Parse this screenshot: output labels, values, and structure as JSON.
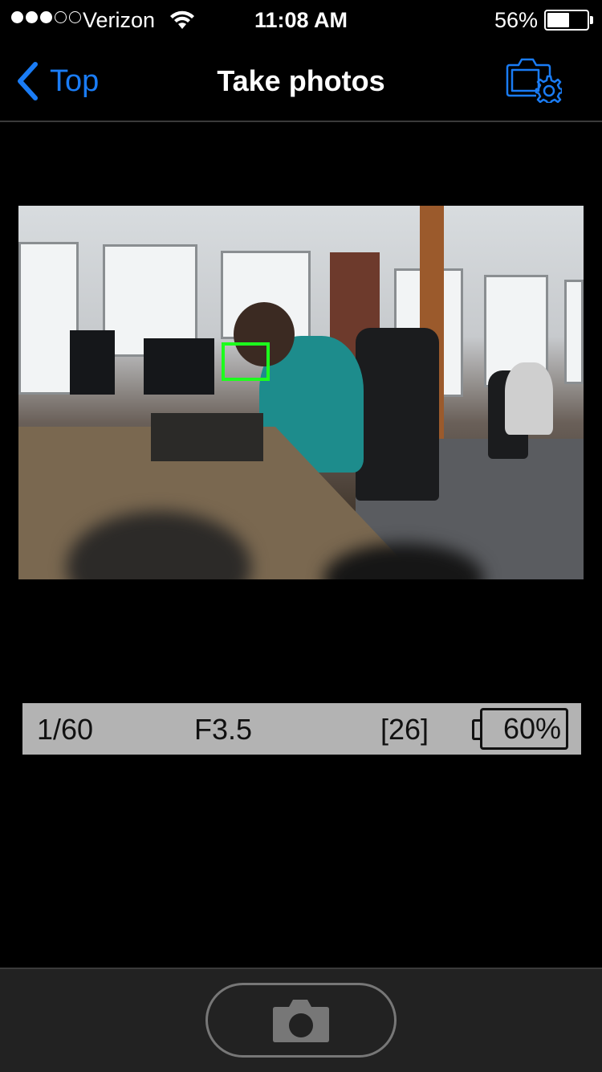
{
  "status_bar": {
    "signal_bars_filled": 3,
    "signal_bars_total": 5,
    "carrier": "Verizon",
    "wifi_icon": "wifi-icon",
    "time": "11:08 AM",
    "battery_percent_label": "56%",
    "battery_level": 0.56
  },
  "nav": {
    "back_label": "Top",
    "title": "Take photos",
    "settings_icon": "camera-settings-icon"
  },
  "live_view": {
    "description": "Live camera view of an office with a person at a desk",
    "focus_box_color": "#1dff1d"
  },
  "camera_info": {
    "shutter_speed": "1/60",
    "aperture": "F3.5",
    "remaining_shots": "[26]",
    "battery_label": "60%",
    "battery_level": 0.6
  },
  "toolbar": {
    "capture_icon": "camera-icon"
  },
  "colors": {
    "accent": "#1a7cf5",
    "background": "#000000",
    "toolbar": "#222222",
    "info_bar": "#b3b3b3"
  }
}
